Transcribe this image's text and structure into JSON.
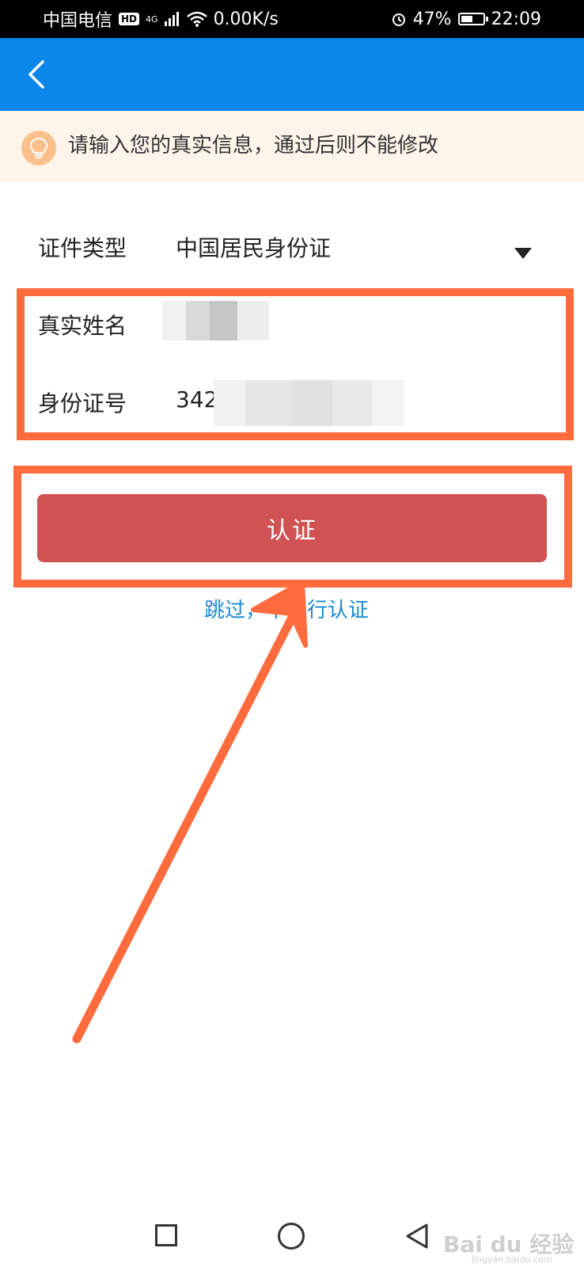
{
  "status_bar": {
    "carrier": "中国电信",
    "hd_badge": "HD",
    "network": "4G",
    "speed": "0.00K/s",
    "battery_percent": "47%",
    "time": "22:09"
  },
  "banner": {
    "text": "请输入您的真实信息，通过后则不能修改"
  },
  "form": {
    "id_type_label": "证件类型",
    "id_type_value": "中国居民身份证",
    "name_label": "真实姓名",
    "id_number_label": "身份证号",
    "id_number_prefix": "342"
  },
  "actions": {
    "submit_label": "认证",
    "skip_label": "跳过，不进行认证"
  },
  "watermark": {
    "brand": "Bai du 经验",
    "url": "jingyan.baidu.com"
  },
  "colors": {
    "navbar": "#0a87e8",
    "submit": "#d15253",
    "highlight": "#ff6b3d",
    "link": "#1a8ad6"
  }
}
